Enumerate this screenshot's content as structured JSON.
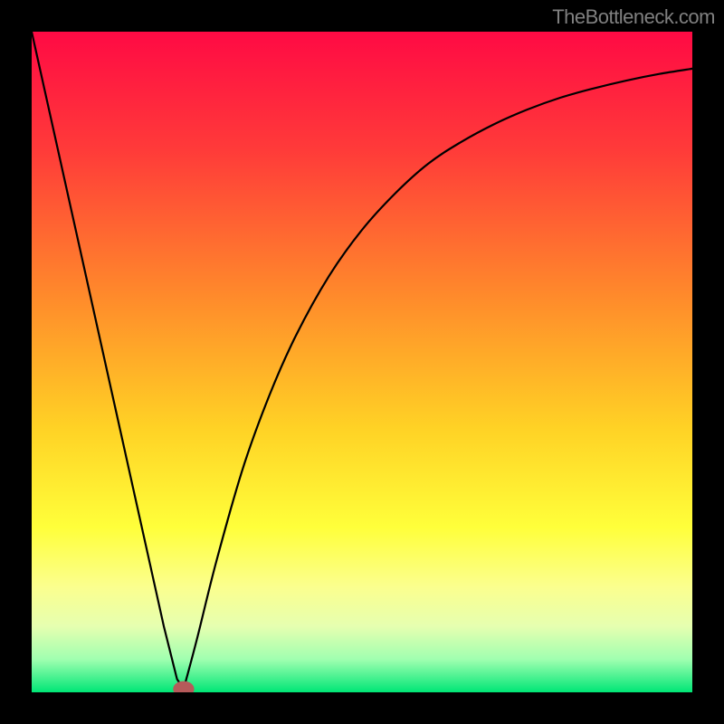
{
  "attribution": "TheBottleneck.com",
  "chart_data": {
    "type": "line",
    "title": "",
    "xlabel": "",
    "ylabel": "",
    "xlim": [
      0,
      100
    ],
    "ylim": [
      0,
      100
    ],
    "gradient_stops": [
      {
        "offset": 0,
        "color": "#ff0a44"
      },
      {
        "offset": 18,
        "color": "#ff3b39"
      },
      {
        "offset": 40,
        "color": "#ff8a2b"
      },
      {
        "offset": 60,
        "color": "#ffd225"
      },
      {
        "offset": 75,
        "color": "#ffff3a"
      },
      {
        "offset": 84,
        "color": "#fbff8e"
      },
      {
        "offset": 90,
        "color": "#e6ffb0"
      },
      {
        "offset": 95,
        "color": "#a0ffb0"
      },
      {
        "offset": 100,
        "color": "#00e676"
      }
    ],
    "series": [
      {
        "name": "left-branch",
        "x": [
          0,
          2,
          4,
          6,
          8,
          10,
          12,
          14,
          16,
          18,
          20,
          21,
          22,
          23
        ],
        "values": [
          100,
          91,
          82,
          73,
          64,
          55,
          46,
          37,
          28,
          19,
          10,
          6,
          2,
          0.5
        ]
      },
      {
        "name": "right-branch",
        "x": [
          23,
          25,
          28,
          32,
          36,
          40,
          45,
          50,
          55,
          60,
          65,
          70,
          75,
          80,
          85,
          90,
          95,
          100
        ],
        "values": [
          0.5,
          8,
          20,
          34,
          45,
          54,
          63,
          70,
          75.5,
          80,
          83.3,
          86,
          88.2,
          90,
          91.4,
          92.6,
          93.6,
          94.4
        ]
      }
    ],
    "marker": {
      "cx": 23,
      "cy": 0.5,
      "rx": 1.6,
      "ry": 1.2,
      "color": "#b65a5a"
    }
  }
}
